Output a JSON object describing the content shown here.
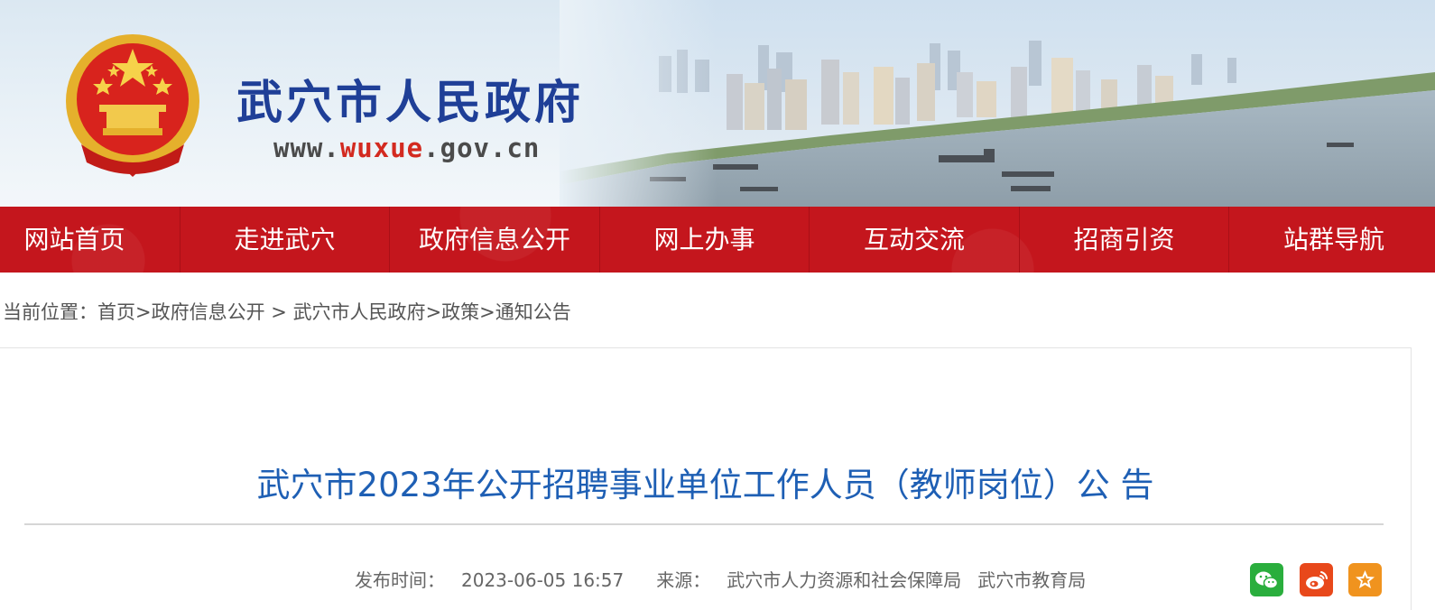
{
  "header": {
    "site_title": "武穴市人民政府",
    "url_prefix": "www.",
    "url_highlight": "wuxue",
    "url_suffix": ".gov.cn",
    "emblem_icon": "national-emblem-icon",
    "colors": {
      "title": "#1f3f97",
      "url_highlight": "#d32a20"
    }
  },
  "nav": {
    "items": [
      {
        "label": "网站首页"
      },
      {
        "label": "走进武穴"
      },
      {
        "label": "政府信息公开"
      },
      {
        "label": "网上办事"
      },
      {
        "label": "互动交流"
      },
      {
        "label": "招商引资"
      },
      {
        "label": "站群导航"
      }
    ],
    "color": "#c4161d"
  },
  "breadcrumb": {
    "prefix": "当前位置：",
    "items": [
      "首页",
      "政府信息公开",
      "武穴市人民政府",
      "政策",
      "通知公告"
    ],
    "separators": [
      ">",
      " > ",
      ">",
      ">"
    ]
  },
  "article": {
    "title": "武穴市2023年公开招聘事业单位工作人员（教师岗位）公 告",
    "publish_label": "发布时间：",
    "publish_time": "2023-06-05 16:57",
    "source_label": "来源：",
    "sources": [
      "武穴市人力资源和社会保障局",
      "武穴市教育局"
    ],
    "title_color": "#1e5fb4"
  },
  "share": {
    "buttons": [
      {
        "icon": "wechat-icon",
        "color": "#2aae3d"
      },
      {
        "icon": "weibo-icon",
        "color": "#e8481b"
      },
      {
        "icon": "favorite-star-icon",
        "color": "#f0931e"
      }
    ]
  }
}
